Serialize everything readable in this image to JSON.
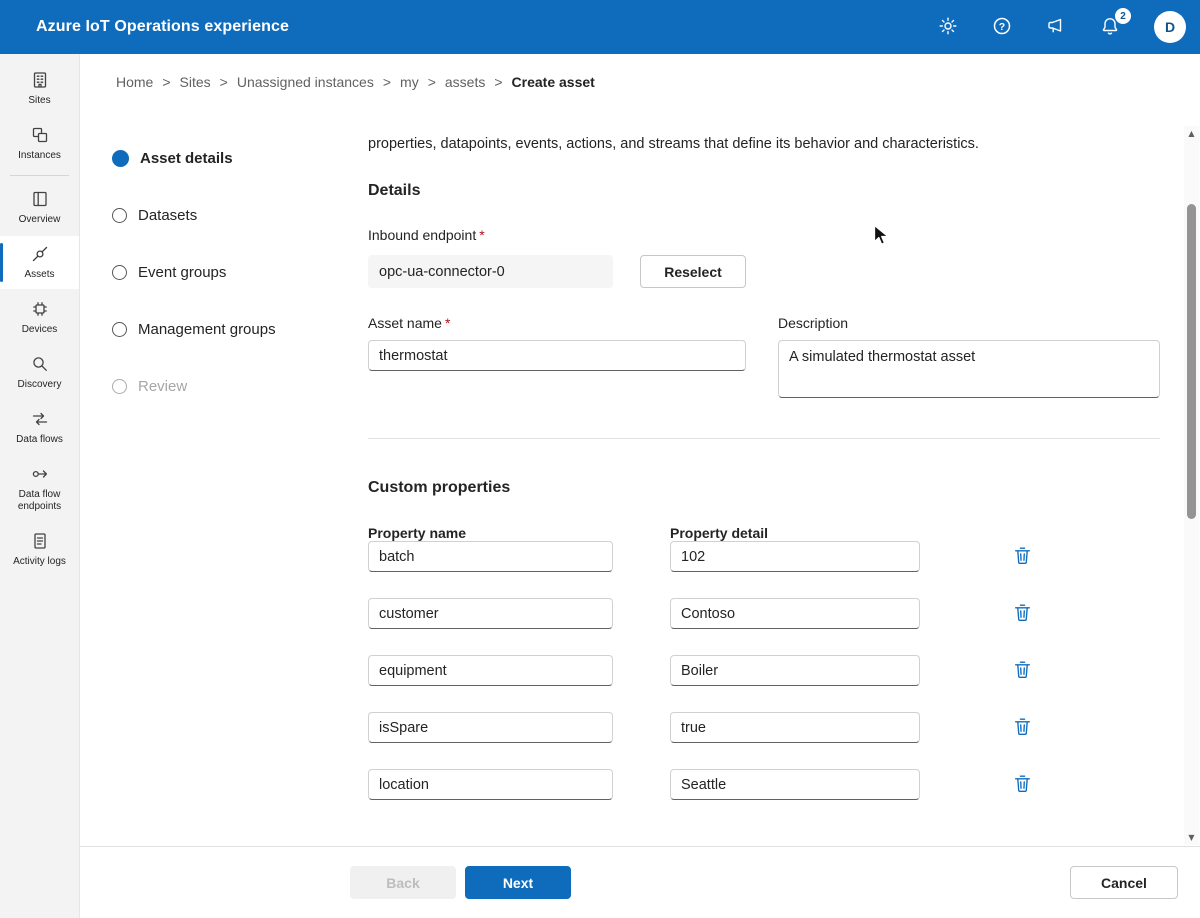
{
  "app": {
    "title": "Azure IoT Operations experience",
    "notification_count": "2",
    "avatar_initial": "D",
    "brand_color": "#0f6cbd"
  },
  "breadcrumb": {
    "separator": ">",
    "items": [
      "Home",
      "Sites",
      "Unassigned instances",
      "my",
      "assets"
    ],
    "current": "Create asset"
  },
  "sidebar": {
    "items": [
      {
        "label": "Sites",
        "icon": "sites-icon"
      },
      {
        "label": "Instances",
        "icon": "instances-icon"
      },
      {
        "label": "Overview",
        "icon": "overview-icon"
      },
      {
        "label": "Assets",
        "icon": "assets-icon",
        "selected": true
      },
      {
        "label": "Devices",
        "icon": "devices-icon"
      },
      {
        "label": "Discovery",
        "icon": "discovery-icon"
      },
      {
        "label": "Data flows",
        "icon": "data-flows-icon"
      },
      {
        "label": "Data flow endpoints",
        "icon": "data-flow-endpoints-icon"
      },
      {
        "label": "Activity logs",
        "icon": "activity-logs-icon"
      }
    ]
  },
  "steps": [
    {
      "label": "Asset details",
      "state": "active"
    },
    {
      "label": "Datasets",
      "state": "default"
    },
    {
      "label": "Event groups",
      "state": "default"
    },
    {
      "label": "Management groups",
      "state": "default"
    },
    {
      "label": "Review",
      "state": "disabled"
    }
  ],
  "form": {
    "intro_text": "properties, datapoints, events, actions, and streams that define its behavior and characteristics.",
    "details_heading": "Details",
    "inbound_endpoint": {
      "label": "Inbound endpoint",
      "required": "*",
      "value": "opc-ua-connector-0",
      "reselect_label": "Reselect"
    },
    "asset_name": {
      "label": "Asset name",
      "required": "*",
      "value": "thermostat"
    },
    "description": {
      "label": "Description",
      "value": "A simulated thermostat asset"
    },
    "custom_properties": {
      "heading": "Custom properties",
      "name_header": "Property name",
      "detail_header": "Property detail",
      "rows": [
        {
          "name": "batch",
          "detail": "102"
        },
        {
          "name": "customer",
          "detail": "Contoso"
        },
        {
          "name": "equipment",
          "detail": "Boiler"
        },
        {
          "name": "isSpare",
          "detail": "true"
        },
        {
          "name": "location",
          "detail": "Seattle"
        }
      ]
    }
  },
  "footer": {
    "back_label": "Back",
    "next_label": "Next",
    "cancel_label": "Cancel"
  }
}
